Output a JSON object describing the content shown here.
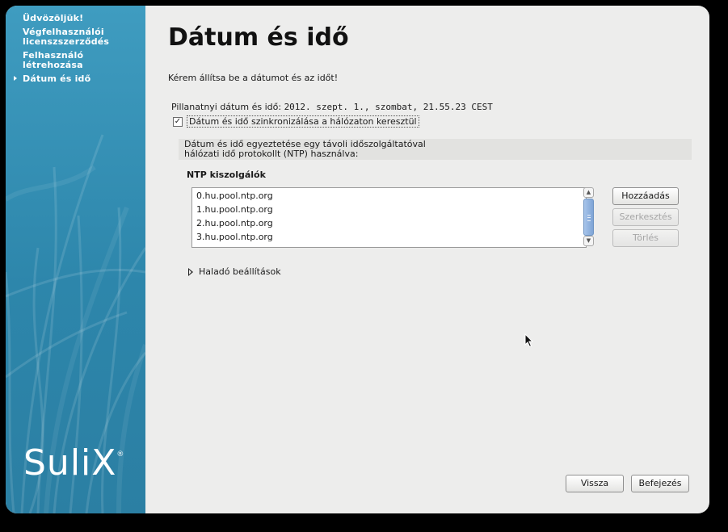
{
  "sidebar": {
    "steps": [
      {
        "label": "Üdvözöljük!",
        "current": false
      },
      {
        "label": "Végfelhasználói licenszszerződés",
        "current": false
      },
      {
        "label": "Felhasználó létrehozása",
        "current": false
      },
      {
        "label": "Dátum és idő",
        "current": true
      }
    ],
    "logo": "SuliX",
    "logo_mark": "®"
  },
  "content": {
    "title": "Dátum és idő",
    "intro": "Kérem állítsa be a dátumot és az időt!",
    "current_label": "Pillanatnyi dátum és idő:",
    "current_value": "2012. szept.  1., szombat, 21.55.23 CEST",
    "sync_checked": true,
    "sync_check_glyph": "✓",
    "sync_label": "Dátum és idő  szinkronizálása a hálózaton keresztül",
    "info_line1": "Dátum és idő egyeztetése egy távoli időszolgáltatóval",
    "info_line2": "hálózati idő protokollt (NTP) használva:",
    "ntp_title": "NTP kiszolgálók",
    "servers": [
      "0.hu.pool.ntp.org",
      "1.hu.pool.ntp.org",
      "2.hu.pool.ntp.org",
      "3.hu.pool.ntp.org"
    ],
    "buttons": {
      "add": "Hozzáadás",
      "edit": "Szerkesztés",
      "delete": "Törlés"
    },
    "advanced": "Haladó beállítások"
  },
  "footer": {
    "back": "Vissza",
    "finish": "Befejezés"
  },
  "colors": {
    "sidebar": "#2d86ab",
    "background": "#ededec",
    "scroll_thumb": "#7fa5d6"
  },
  "icons": {
    "step_marker": "triangle-right",
    "expander": "triangle-right",
    "scroll_up": "chevron-up",
    "scroll_down": "chevron-down"
  }
}
